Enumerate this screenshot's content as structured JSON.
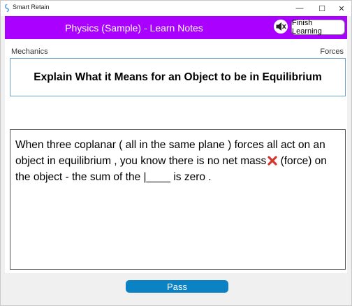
{
  "window": {
    "title": "Smart Retain",
    "minimize_glyph": "—",
    "maximize_glyph": "☐",
    "close_glyph": "✕",
    "app_icon": "smart-retain-logo"
  },
  "header": {
    "title": "Physics (Sample) - Learn Notes",
    "background_color": "#aa00ff",
    "mute_icon": "speaker-muted-icon",
    "finish_label": "Finish Learning"
  },
  "card": {
    "topic": "Mechanics",
    "subtopic": "Forces",
    "question": "Explain What it Means for an Object to be in Equilibrium",
    "answer_part1": "When three coplanar ( all in the same plane ) forces all act on an object in equilibrium , you know there is no net mass",
    "answer_part2": " (force) on the object - the sum of the |____ is zero .",
    "wrong_word_icon": "red-cross-icon"
  },
  "footer": {
    "pass_label": "Pass",
    "pass_color": "#0a82c4"
  }
}
